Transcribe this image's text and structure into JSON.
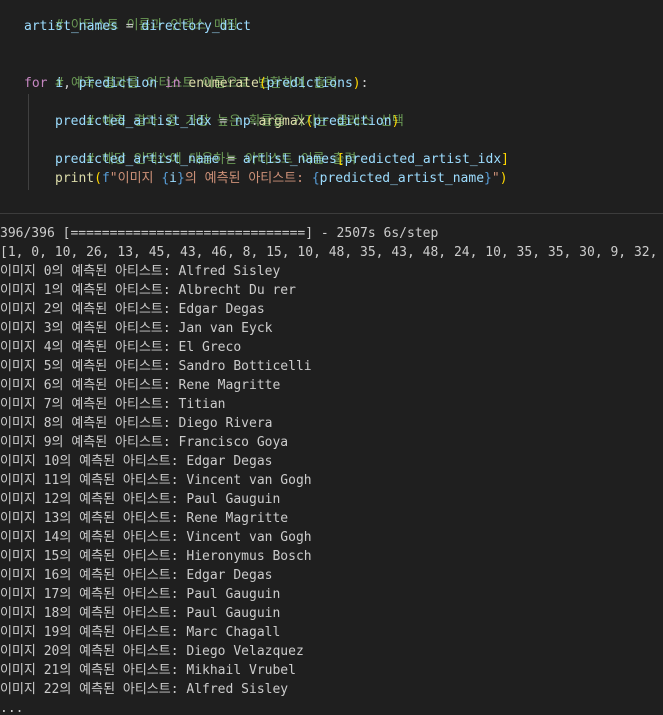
{
  "code": {
    "c1": "# 아티스트 이름과 인덱스 매핑",
    "l2_var": "artist_names",
    "l2_op": " = ",
    "l2_val": "directory_dict",
    "c3": "# 예측 결과를 아티스트 이름으로 변환하여 출력",
    "l4_for": "for",
    "l4_i": "i",
    "l4_comma": ", ",
    "l4_pred": "prediction",
    "l4_in": "in",
    "l4_enum": "enumerate",
    "l4_preds": "predictions",
    "c5": "# 예측 결과 중 가장 높은 확률을 가지는 클래스 선택",
    "l6_var": "predicted_artist_idx",
    "l6_np": "np",
    "l6_fn": "argmax",
    "l6_arg": "prediction",
    "c7": "# 해당 인덱스에 대응하는 아티스트 이름 출력",
    "l8_var": "predicted_artist_name",
    "l8_names": "artist_names",
    "l8_idx": "predicted_artist_idx",
    "l9_print": "print",
    "l9_f": "f",
    "l9_s1": "\"이미지 ",
    "l9_v1": "i",
    "l9_s2": "의 예측된 아티스트: ",
    "l9_v2": "predicted_artist_name",
    "l9_s3": "\""
  },
  "output": {
    "progress": "396/396 [==============================] - 2507s 6s/step",
    "array_line": "[1, 0, 10, 26, 13, 45, 43, 46, 8, 15, 10, 48, 35, 43, 48, 24, 10, 35, 35, 30, 9, 32, 1,",
    "prefix": "이미지 ",
    "suffix": "의 예측된 아티스트: ",
    "lines": [
      {
        "i": "0",
        "name": "Alfred Sisley"
      },
      {
        "i": "1",
        "name": "Albrecht Du rer"
      },
      {
        "i": "2",
        "name": "Edgar Degas"
      },
      {
        "i": "3",
        "name": "Jan van Eyck"
      },
      {
        "i": "4",
        "name": "El Greco"
      },
      {
        "i": "5",
        "name": "Sandro Botticelli"
      },
      {
        "i": "6",
        "name": "Rene Magritte"
      },
      {
        "i": "7",
        "name": "Titian"
      },
      {
        "i": "8",
        "name": "Diego Rivera"
      },
      {
        "i": "9",
        "name": "Francisco Goya"
      },
      {
        "i": "10",
        "name": "Edgar Degas"
      },
      {
        "i": "11",
        "name": "Vincent van Gogh"
      },
      {
        "i": "12",
        "name": "Paul Gauguin"
      },
      {
        "i": "13",
        "name": "Rene Magritte"
      },
      {
        "i": "14",
        "name": "Vincent van Gogh"
      },
      {
        "i": "15",
        "name": "Hieronymus Bosch"
      },
      {
        "i": "16",
        "name": "Edgar Degas"
      },
      {
        "i": "17",
        "name": "Paul Gauguin"
      },
      {
        "i": "18",
        "name": "Paul Gauguin"
      },
      {
        "i": "19",
        "name": "Marc Chagall"
      },
      {
        "i": "20",
        "name": "Diego Velazquez"
      },
      {
        "i": "21",
        "name": "Mikhail Vrubel"
      },
      {
        "i": "22",
        "name": "Alfred Sisley"
      }
    ],
    "ellipsis": "..."
  }
}
